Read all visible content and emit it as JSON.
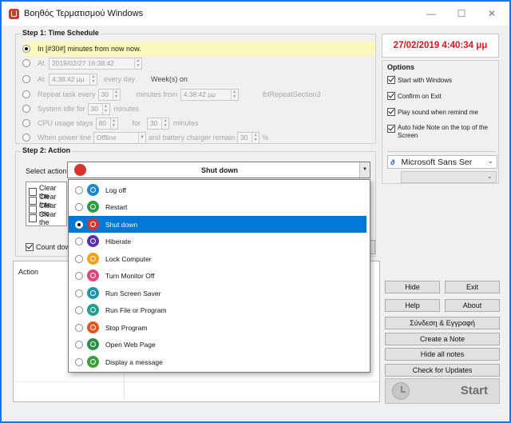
{
  "window": {
    "title": "Βοηθός Τερματισμού Windows",
    "minimize": "—",
    "maximize": "☐",
    "close": "✕"
  },
  "step1": {
    "legend": "Step 1:  Time Schedule",
    "in_text": "In [#30#] minutes from now  now.",
    "at_label": "At",
    "at_value": "2019/02/27  16:38:42",
    "at2_label": "At",
    "at2_value": "4:38:42 μμ",
    "every_day": "every day",
    "weeks_on": "Week(s) on",
    "repeat_label": "Repeat task every",
    "repeat_value": "30",
    "minutes_from": "minutes from",
    "repeat_time": "4:38:42 μμ",
    "repeat_section": "lblRepeatSection3",
    "idle_label": "System idle for",
    "idle_value": "30",
    "idle_unit": "minutes",
    "cpu_label": "CPU usage stays",
    "cpu_value": "80",
    "cpu_for": "for",
    "cpu_minutes_value": "30",
    "cpu_unit": "minutes",
    "power_label": "When power line",
    "power_value": "Offline",
    "battery_label": "and battery charger remain",
    "battery_value": "30",
    "percent": "%"
  },
  "clock": {
    "text": "27/02/2019 4:40:34 μμ",
    "color": "#e0151b"
  },
  "options": {
    "title": "Options",
    "items": [
      {
        "label": "Start with Windows",
        "checked": true
      },
      {
        "label": "Confirm on Exit",
        "checked": true
      },
      {
        "label": "Play sound when remind me",
        "checked": true
      },
      {
        "label": "Auto hide Note on the top of the Screen",
        "checked": true
      }
    ],
    "font_value": "Microsoft Sans Ser",
    "font_prefix": "ð"
  },
  "step2": {
    "legend": "Step 2:  Action",
    "select_label": "Select action:",
    "selected": "Shut down",
    "clear_items": [
      "Clear the",
      "Clear Inte",
      "Clear rec",
      "Clear the"
    ],
    "count_label": "Count dow"
  },
  "action_panel": {
    "header": "Action"
  },
  "dropdown": {
    "options": [
      {
        "label": "Log off",
        "color": "#1c87c9",
        "selected": false
      },
      {
        "label": "Restart",
        "color": "#2e9b45",
        "selected": false
      },
      {
        "label": "Shut down",
        "color": "#d9342b",
        "selected": true
      },
      {
        "label": "Hiberate",
        "color": "#5b2fa6",
        "selected": false
      },
      {
        "label": "Lock Computer",
        "color": "#f0a31a",
        "selected": false
      },
      {
        "label": "Turn Monitor Off",
        "color": "#e0457b",
        "selected": false
      },
      {
        "label": "Run Screen Saver",
        "color": "#1e98a8",
        "selected": false
      },
      {
        "label": "Run File or Program",
        "color": "#1f9f8c",
        "selected": false
      },
      {
        "label": "Stop Program",
        "color": "#e2561f",
        "selected": false
      },
      {
        "label": "Open Web Page",
        "color": "#2a8f48",
        "selected": false
      },
      {
        "label": "Display a message",
        "color": "#3b9e3b",
        "selected": false
      }
    ]
  },
  "buttons": {
    "hide": "Hide",
    "exit": "Exit",
    "help": "Help",
    "about": "About",
    "connect": "Σύνδεση & Εγγραφή",
    "create_note": "Create a Note",
    "hide_notes": "Hide all notes",
    "check_updates": "Check for Updates",
    "start": "Start"
  }
}
